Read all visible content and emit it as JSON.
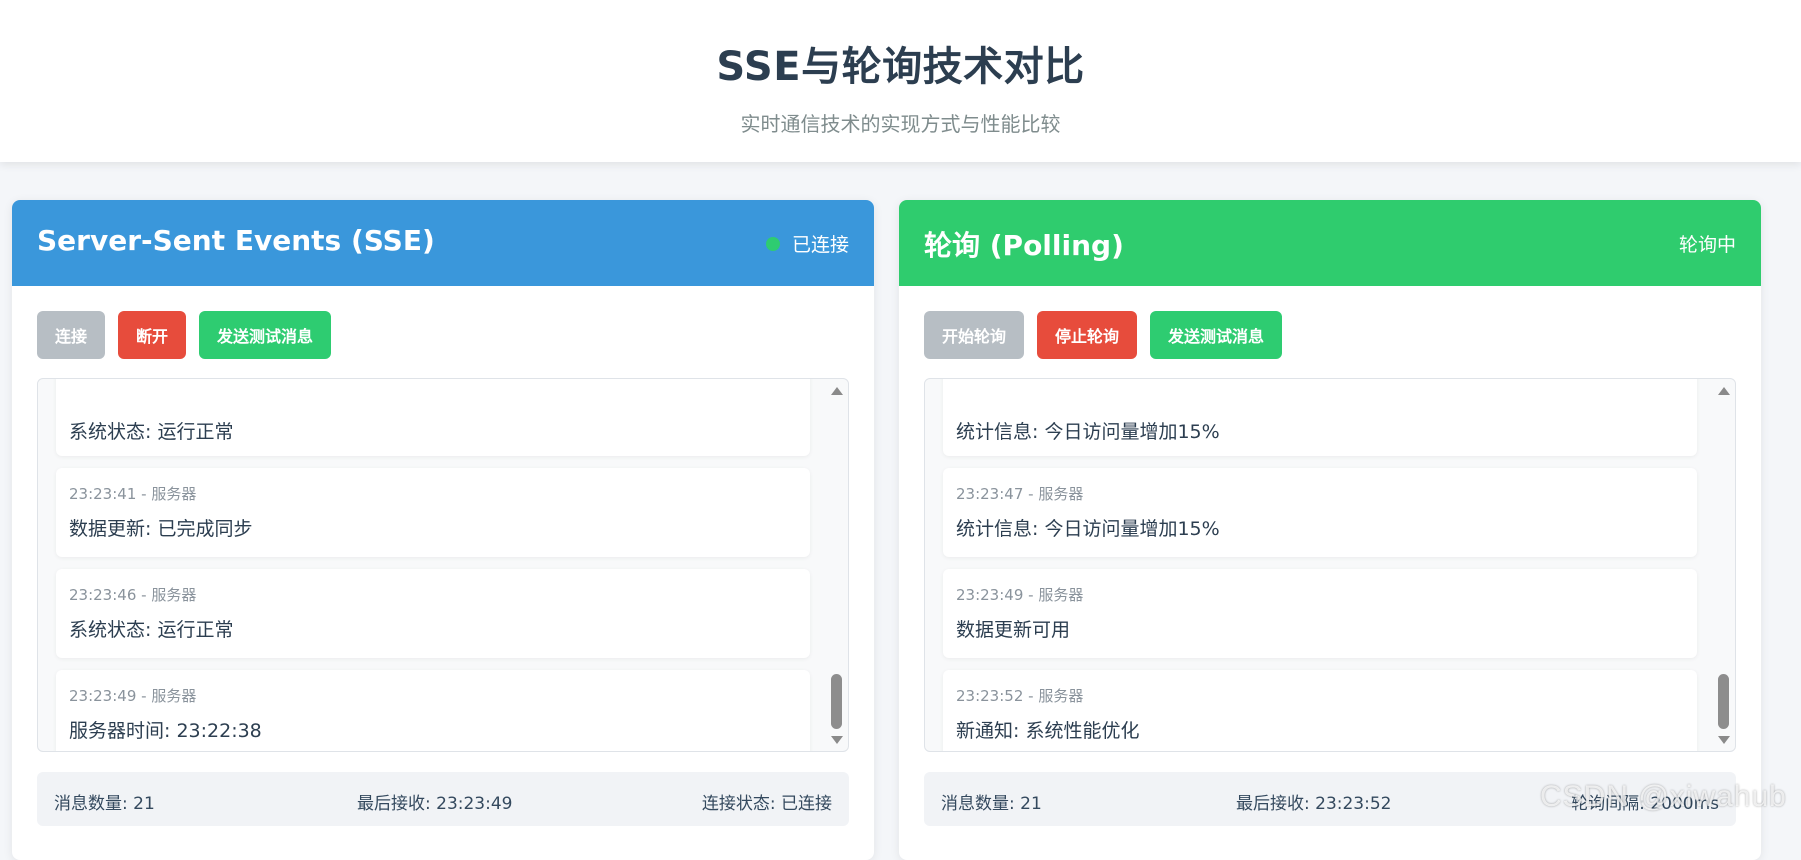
{
  "header": {
    "title": "SSE与轮询技术对比",
    "subtitle": "实时通信技术的实现方式与性能比较"
  },
  "colors": {
    "sse_header": "#3a97db",
    "polling_header": "#2fcc6e",
    "btn_disabled": "#b7bec4",
    "btn_red": "#e74c3c",
    "btn_green": "#2ecc71",
    "status_dot": "#2ecc71"
  },
  "sse": {
    "title": "Server-Sent Events (SSE)",
    "status": "已连接",
    "buttons": {
      "connect": "连接",
      "disconnect": "断开",
      "send_test": "发送测试消息"
    },
    "messages": [
      {
        "meta": "",
        "text": "系统状态: 运行正常"
      },
      {
        "meta": "23:23:41 - 服务器",
        "text": "数据更新: 已完成同步"
      },
      {
        "meta": "23:23:46 - 服务器",
        "text": "系统状态: 运行正常"
      },
      {
        "meta": "23:23:49 - 服务器",
        "text": "服务器时间: 23:22:38"
      }
    ],
    "stats": {
      "count": "消息数量: 21",
      "last": "最后接收: 23:23:49",
      "state": "连接状态: 已连接"
    }
  },
  "polling": {
    "title": "轮询 (Polling)",
    "status": "轮询中",
    "buttons": {
      "start": "开始轮询",
      "stop": "停止轮询",
      "send_test": "发送测试消息"
    },
    "messages": [
      {
        "meta": "",
        "text": "统计信息: 今日访问量增加15%"
      },
      {
        "meta": "23:23:47 - 服务器",
        "text": "统计信息: 今日访问量增加15%"
      },
      {
        "meta": "23:23:49 - 服务器",
        "text": "数据更新可用"
      },
      {
        "meta": "23:23:52 - 服务器",
        "text": "新通知: 系统性能优化"
      }
    ],
    "stats": {
      "count": "消息数量: 21",
      "last": "最后接收: 23:23:52",
      "interval": "轮询间隔: 2000ms"
    }
  },
  "watermark": "CSDN @xiwahub"
}
